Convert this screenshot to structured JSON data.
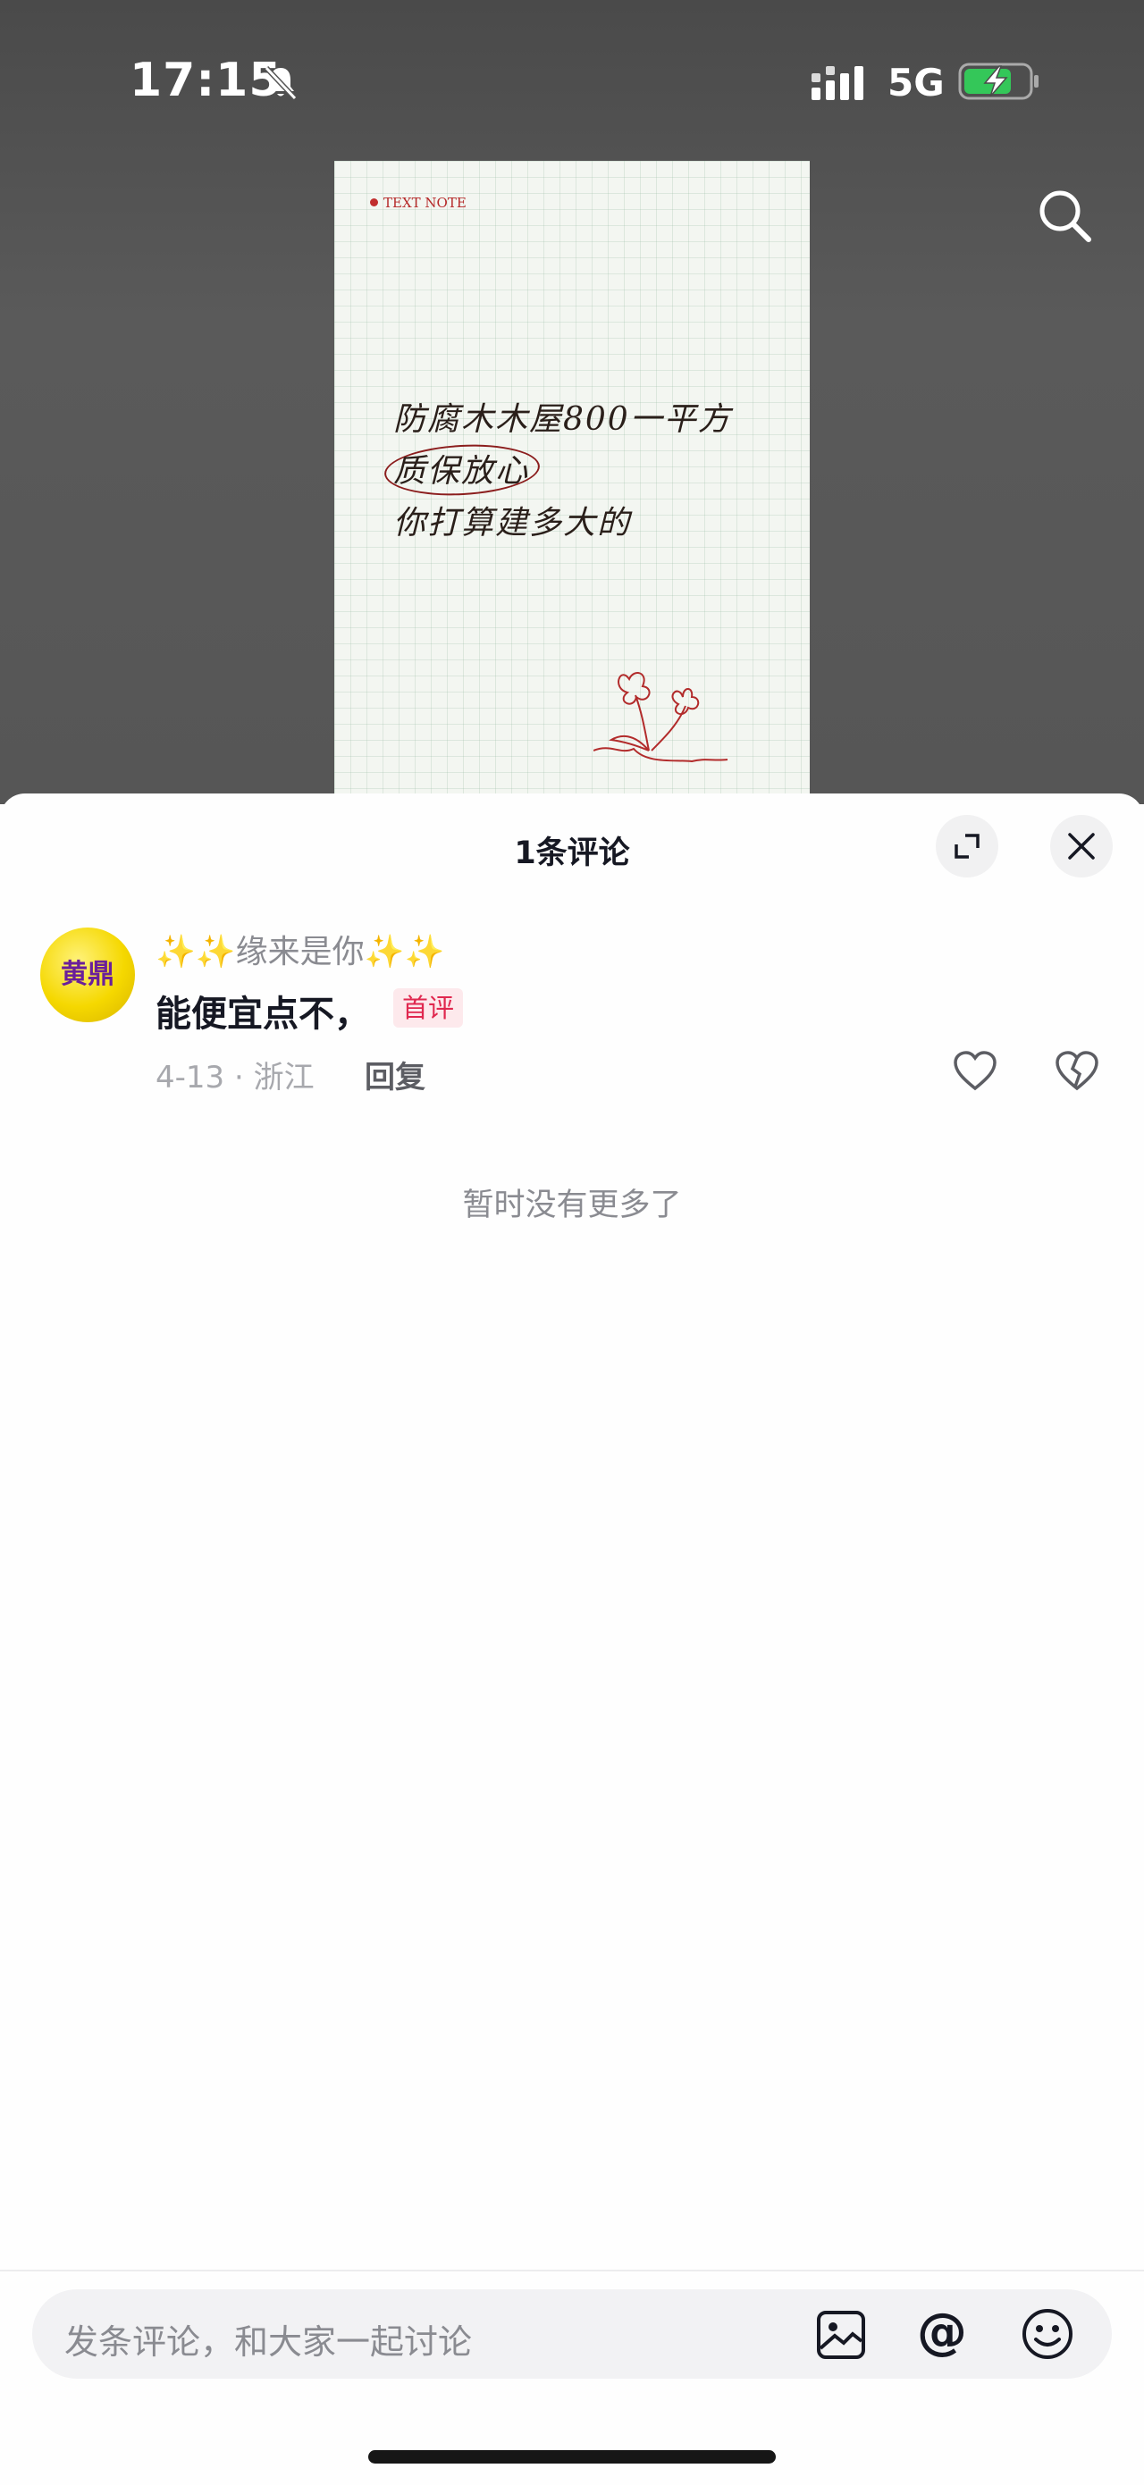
{
  "status_bar": {
    "time": "17:15",
    "network": "5G"
  },
  "video_note": {
    "tag": "TEXT NOTE",
    "lines": [
      "防腐木木屋800一平方",
      "质保放心",
      "你打算建多大的"
    ]
  },
  "comments_sheet": {
    "title": "1条评论",
    "comment": {
      "avatar_text": "黄鼎",
      "username": "✨✨缘来是你✨✨",
      "text": "能便宜点不，",
      "badge": "首评",
      "meta": "4-13 · 浙江",
      "reply_label": "回复"
    },
    "end_text": "暂时没有更多了"
  },
  "input": {
    "placeholder": "发条评论，和大家一起讨论",
    "at_symbol": "@"
  },
  "colors": {
    "accent_badge": "#e0284f",
    "text_primary": "#161823",
    "text_secondary": "#8a8b91"
  }
}
